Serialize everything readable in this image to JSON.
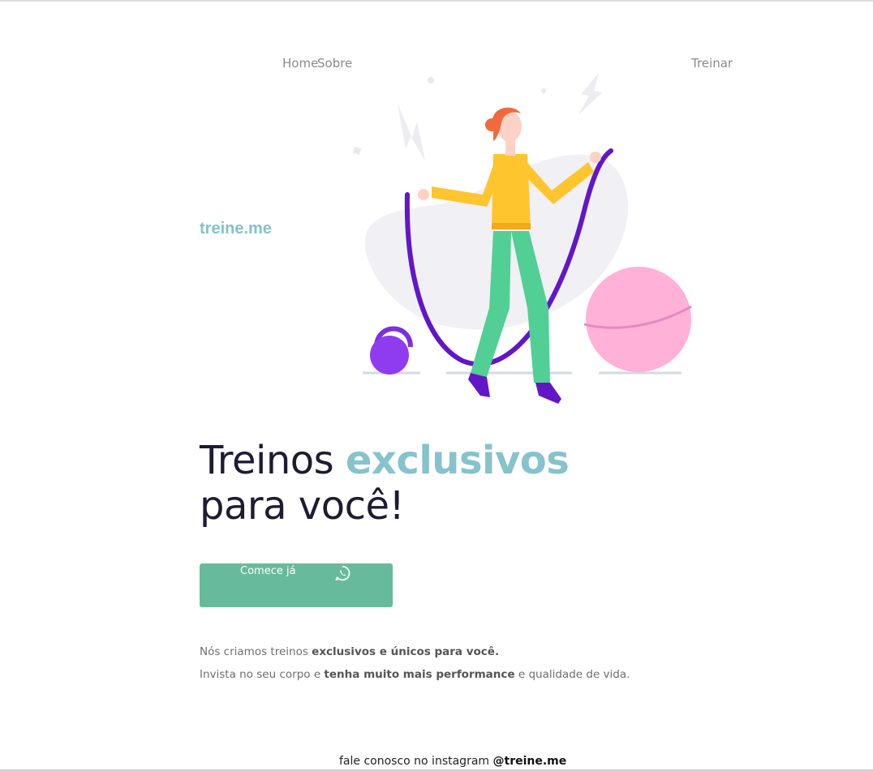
{
  "nav": {
    "home_label": "Home",
    "about_label": "Sobre",
    "train_label": "Treinar"
  },
  "brand": {
    "name": "treine.me"
  },
  "hero": {
    "headline_part1": "Treinos ",
    "headline_accent": "exclusivos",
    "headline_part2": "para você!",
    "cta_label": "Comece já",
    "cta_icon": "whatsapp-icon"
  },
  "description": {
    "line1_prefix": "Nós criamos treinos ",
    "line1_bold": "exclusivos e únicos para você.",
    "line2_prefix": "Invista no seu corpo e ",
    "line2_bold": "tenha muito mais performance",
    "line2_suffix": " e qualidade de vida."
  },
  "footer": {
    "text": "fale conosco no instagram ",
    "handle": "@treine.me"
  },
  "colors": {
    "brand": "#84c2cc",
    "accent": "#86c3cc",
    "cta": "#67bb9c",
    "headline": "#1e1b33"
  }
}
